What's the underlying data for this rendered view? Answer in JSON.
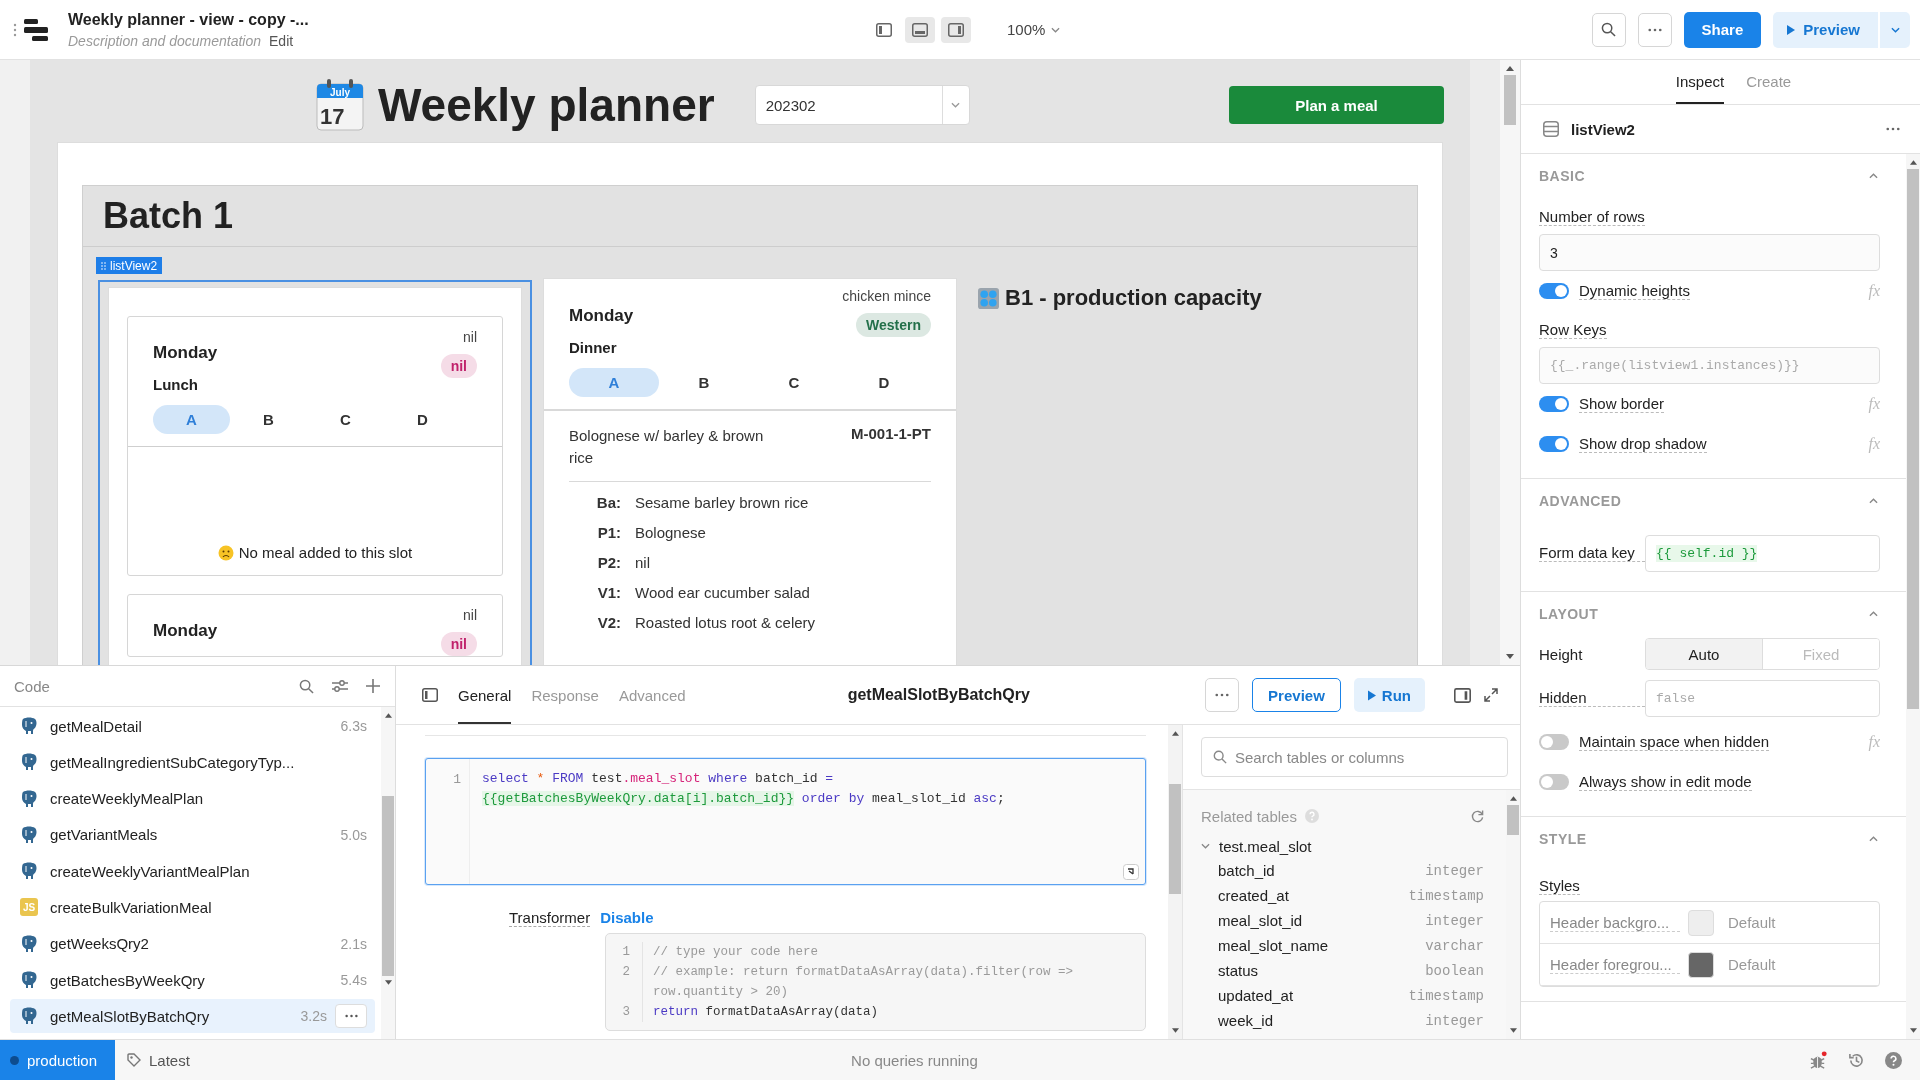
{
  "header": {
    "title": "Weekly planner - view - copy -...",
    "description": "Description and documentation",
    "edit": "Edit",
    "panel_toggles": [
      {
        "kind": "left",
        "on": false
      },
      {
        "kind": "bottom",
        "on": true
      },
      {
        "kind": "right",
        "on": true
      }
    ],
    "zoom": "100%",
    "share": "Share",
    "preview": "Preview"
  },
  "canvas": {
    "calendar": {
      "month": "July",
      "day": "17"
    },
    "title": "Weekly planner",
    "week_select": {
      "value": "202302"
    },
    "plan_button": "Plan a meal",
    "batch": {
      "title": "Batch 1",
      "selection_tag": "listView2",
      "left_slots": [
        {
          "day": "Monday",
          "meal": "Lunch",
          "note": "nil",
          "tag": {
            "label": "nil",
            "color": "#c0226b"
          },
          "variants": [
            {
              "label": "A",
              "selected": true
            },
            {
              "label": "B",
              "selected": false
            },
            {
              "label": "C",
              "selected": false
            },
            {
              "label": "D",
              "selected": false
            }
          ],
          "empty_message": "No meal added to this slot"
        },
        {
          "day": "Monday",
          "note": "nil",
          "tag": {
            "label": "nil",
            "color": "#c0226b"
          }
        }
      ],
      "detail_card": {
        "day": "Monday",
        "meal": "Dinner",
        "note": "chicken mince",
        "tag": {
          "label": "Western",
          "color": "#23704a"
        },
        "variants": [
          {
            "label": "A",
            "selected": true
          },
          {
            "label": "B",
            "selected": false
          },
          {
            "label": "C",
            "selected": false
          },
          {
            "label": "D",
            "selected": false
          }
        ],
        "dish": "Bolognese w/ barley & brown rice",
        "code": "M-001-1-PT",
        "components": [
          {
            "key": "Ba:",
            "value": "Sesame barley brown rice"
          },
          {
            "key": "P1:",
            "value": "Bolognese"
          },
          {
            "key": "P2:",
            "value": "nil"
          },
          {
            "key": "V1:",
            "value": "Wood ear cucumber salad"
          },
          {
            "key": "V2:",
            "value": "Roasted lotus root & celery"
          }
        ]
      },
      "capacity_title": "B1 - production capacity"
    }
  },
  "code_panel": {
    "title": "Code",
    "queries": [
      {
        "name": "getMealDetail",
        "kind": "postgres",
        "time": "6.3s",
        "selected": false
      },
      {
        "name": "getMealIngredientSubCategoryTyp...",
        "kind": "postgres",
        "selected": false
      },
      {
        "name": "createWeeklyMealPlan",
        "kind": "postgres",
        "selected": false
      },
      {
        "name": "getVariantMeals",
        "kind": "postgres",
        "time": "5.0s",
        "selected": false
      },
      {
        "name": "createWeeklyVariantMealPlan",
        "kind": "postgres",
        "selected": false
      },
      {
        "name": "createBulkVariationMeal",
        "kind": "js",
        "badge": "JS",
        "selected": false
      },
      {
        "name": "getWeeksQry2",
        "kind": "postgres",
        "time": "2.1s",
        "selected": false
      },
      {
        "name": "getBatchesByWeekQry",
        "kind": "postgres",
        "time": "5.4s",
        "selected": false
      },
      {
        "name": "getMealSlotByBatchQry",
        "kind": "postgres",
        "time": "3.2s",
        "selected": true
      }
    ]
  },
  "editor": {
    "tabs": [
      {
        "label": "General",
        "selected": true
      },
      {
        "label": "Response",
        "selected": false
      },
      {
        "label": "Advanced",
        "selected": false
      }
    ],
    "query_name": "getMealSlotByBatchQry",
    "preview": "Preview",
    "run": "Run",
    "sql": [
      {
        "number": "1",
        "tokens": [
          {
            "text": "select ",
            "kind": "keyword"
          },
          {
            "text": "* ",
            "kind": "operator"
          },
          {
            "text": "FROM",
            "kind": "keyword"
          },
          {
            "text": " test",
            "kind": "plain"
          },
          {
            "text": ".meal_slot ",
            "kind": "property"
          },
          {
            "text": "where",
            "kind": "keyword"
          },
          {
            "text": " batch_id ",
            "kind": "plain"
          },
          {
            "text": "= ",
            "kind": "keyword"
          },
          {
            "text": "{{getBatchesByWeekQry.data[i].batch_id}}",
            "kind": "template"
          },
          {
            "text": " order by",
            "kind": "keyword"
          },
          {
            "text": " meal_slot_id ",
            "kind": "plain"
          },
          {
            "text": "asc",
            "kind": "keyword"
          },
          {
            "text": ";",
            "kind": "plain"
          }
        ]
      }
    ],
    "transformer": {
      "label": "Transformer",
      "action": "Disable",
      "lines": [
        {
          "number": "1",
          "tokens": [
            {
              "text": "// type your code here",
              "kind": "comment"
            }
          ]
        },
        {
          "number": "2",
          "tokens": [
            {
              "text": "// example: return formatDataAsArray(data).filter(row => row.quantity > 20)",
              "kind": "comment"
            }
          ]
        },
        {
          "number": "3",
          "tokens": [
            {
              "text": "return",
              "kind": "keyword"
            },
            {
              "text": " formatDataAsArray(data)",
              "kind": "plain"
            }
          ]
        }
      ]
    }
  },
  "schema": {
    "search_placeholder": "Search tables or columns",
    "heading": "Related tables",
    "table": {
      "name": "test.meal_slot",
      "expanded": true,
      "columns": [
        {
          "name": "batch_id",
          "type": "integer"
        },
        {
          "name": "created_at",
          "type": "timestamp"
        },
        {
          "name": "meal_slot_id",
          "type": "integer"
        },
        {
          "name": "meal_slot_name",
          "type": "varchar"
        },
        {
          "name": "status",
          "type": "boolean"
        },
        {
          "name": "updated_at",
          "type": "timestamp"
        },
        {
          "name": "week_id",
          "type": "integer"
        }
      ]
    }
  },
  "inspector": {
    "tabs": [
      {
        "label": "Inspect",
        "selected": true
      },
      {
        "label": "Create",
        "selected": false
      }
    ],
    "component": "listView2",
    "sections": [
      {
        "title": "BASIC",
        "expanded": true,
        "rows": [
          {
            "kind": "input",
            "label": "Number of rows",
            "value": "3"
          },
          {
            "kind": "toggle",
            "label": "Dynamic heights",
            "on": true,
            "fx": "fx"
          },
          {
            "kind": "input",
            "label": "Row Keys",
            "placeholder": "{{_.range(listview1.instances)}}"
          },
          {
            "kind": "toggle",
            "label": "Show border",
            "on": true,
            "fx": "fx"
          },
          {
            "kind": "toggle",
            "label": "Show drop shadow",
            "on": true,
            "fx": "fx"
          }
        ]
      },
      {
        "title": "ADVANCED",
        "expanded": true,
        "rows": [
          {
            "kind": "inline-code",
            "label": "Form data key",
            "value": "{{ self.id }}"
          }
        ]
      },
      {
        "title": "LAYOUT",
        "expanded": true,
        "rows": [
          {
            "kind": "segmented",
            "label": "Height",
            "options": [
              {
                "label": "Auto",
                "selected": true
              },
              {
                "label": "Fixed",
                "selected": false
              }
            ]
          },
          {
            "kind": "inline-input",
            "label": "Hidden",
            "placeholder": "false"
          },
          {
            "kind": "toggle",
            "label": "Maintain space when hidden",
            "on": false,
            "fx": "fx"
          },
          {
            "kind": "toggle",
            "label": "Always show in edit mode",
            "on": false
          }
        ]
      },
      {
        "title": "STYLE",
        "expanded": true,
        "rows": [
          {
            "kind": "styles",
            "label": "Styles",
            "items": [
              {
                "name": "Header backgro...",
                "color": "#eeeeee",
                "value": "Default"
              },
              {
                "name": "Header foregrou...",
                "color": "#666666",
                "value": "Default"
              }
            ]
          }
        ]
      }
    ]
  },
  "status_bar": {
    "environment": "production",
    "version": "Latest",
    "message": "No queries running",
    "bug_alert": true
  }
}
